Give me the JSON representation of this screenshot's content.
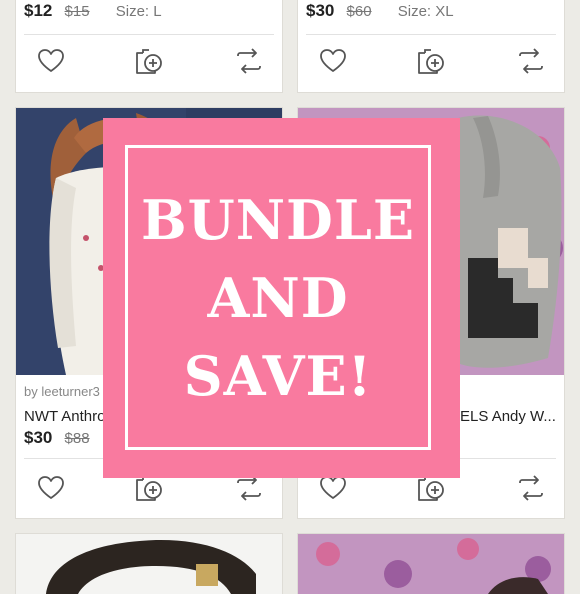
{
  "listings": [
    {
      "price": "$12",
      "original_price": "$15",
      "size": "Size: L"
    },
    {
      "price": "$30",
      "original_price": "$60",
      "size": "Size: XL"
    },
    {
      "seller": "by leeturner3",
      "title": "NWT Anthro",
      "price": "$30",
      "original_price": "$88"
    },
    {
      "title": "ELS Andy W..."
    }
  ],
  "promo": {
    "lines": [
      "BUNDLE",
      "AND",
      "SAVE!"
    ],
    "background": "#f97a9f",
    "text_color": "#ffffff"
  },
  "icons": {
    "like": "heart-icon",
    "bundle": "bundle-add-icon",
    "share": "share-icon"
  },
  "colors": {
    "page_background": "#ecebe6",
    "card_background": "#ffffff",
    "promo_pink": "#f97a9f"
  }
}
